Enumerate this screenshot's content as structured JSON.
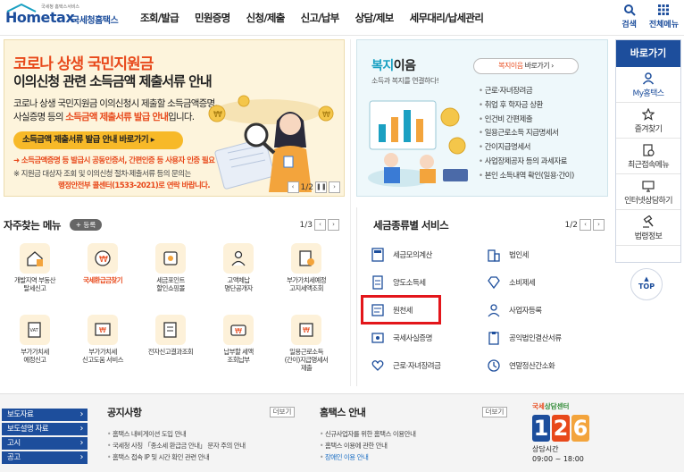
{
  "header": {
    "logo_brand": "Hometax",
    "logo_sub": "국세청 홈택스서비스",
    "logo_agency": "국세청홈택스",
    "menus": [
      "조회/발급",
      "민원증명",
      "신청/제출",
      "신고/납부",
      "상담/제보",
      "세무대리/납세관리"
    ],
    "search_label": "검색",
    "allmenu_label": "전체메뉴"
  },
  "banner": {
    "title1": "코로나 상생 국민지원금",
    "title2": "이의신청 관련 소득금액 제출서류 안내",
    "desc1": "코로나 상생 국민지원금 이의신청시 제출할 소득금액증명,",
    "desc2_pre": "사실증명 등의 ",
    "desc2_hl": "소득금액 제출서류 발급 안내",
    "desc2_post": "입니다.",
    "button": "소득금액 제출서류 발급 안내 바로가기",
    "note1": "➜ 소득금액증명 등 발급시 공동인증서, 간편인증 등 사용자 인증 필요",
    "note2": "※ 지원금 대상자 조회 및 이의신청 절차·제출서류 등의 문의는",
    "note3": "행정안전부 콜센터(1533-2021)로 연락 바랍니다.",
    "pager": "1/2"
  },
  "welfare": {
    "title_hl": "복지",
    "title_dk": "이음",
    "subtitle": "소득과 복지를 연결하다!",
    "go_hl": "복지이음",
    "go_label": " 바로가기",
    "items": [
      "근로·자녀장려금",
      "취업 후 학자금 상환",
      "인건비 간편제출",
      "일용근로소득 지급명세서",
      "간이지급명세서",
      "사업장제공자 등의 과세자료",
      "본인 소득내역 확인(일용·간이)"
    ]
  },
  "quick": {
    "header": "바로가기",
    "items": [
      "My홈택스",
      "즐겨찾기",
      "최근접속메뉴",
      "인터넷상담하기",
      "법령정보"
    ],
    "top": "TOP"
  },
  "freq": {
    "title": "자주찾는 메뉴",
    "register": "+ 등록",
    "pager": "1/3",
    "items": [
      {
        "label": "개발지역 부동산\n탈세신고",
        "red": false
      },
      {
        "label": "국세환급금찾기",
        "red": true
      },
      {
        "label": "세금포인트\n할인쇼핑몰",
        "red": false
      },
      {
        "label": "고액체납\n명단공개자",
        "red": false
      },
      {
        "label": "부가가치세예정\n고지세액조회",
        "red": false
      },
      {
        "label": "부가가치세\n예정신고",
        "red": false
      },
      {
        "label": "부가가치세\n신고도움 서비스",
        "red": false
      },
      {
        "label": "전자신고결과조회",
        "red": false
      },
      {
        "label": "납부할 세액\n조회납부",
        "red": false
      },
      {
        "label": "일용근로소득\n(간이)지급명세서\n제출",
        "red": false
      }
    ]
  },
  "taxsvc": {
    "title": "세금종류별 서비스",
    "pager": "1/2",
    "items": [
      "세금모의계산",
      "법인세",
      "양도소득세",
      "소비제세",
      "원천세",
      "사업자등록",
      "국세사실증명",
      "공익법인결산서류",
      "근로·자녀장려금",
      "연말정산간소화"
    ]
  },
  "footer": {
    "left_buttons": [
      "보도자료",
      "보도설명 자료",
      "고시",
      "공고"
    ],
    "notice_title": "공지사항",
    "notice_more": "더보기",
    "notices": [
      "홈택스 내비게이션 도입 안내",
      "국세청 사칭 「종소세 환급금 안내」 문자 주의 안내",
      "홈택스 접속 IP 및 시간 확인 관련 안내"
    ],
    "news_title": "홈택스 안내",
    "news_more": "더보기",
    "news": [
      "신규사업자를 위한 홈택스 이용안내",
      "홈택스 이용에 관한 안내",
      "장애인 이용 안내"
    ],
    "cc_title_hl": "국세",
    "cc_title": "상담센터",
    "cc_digits": [
      "1",
      "2",
      "6"
    ],
    "cc_hours_label": "상담시간",
    "cc_hours": "09:00 ~ 18:00"
  }
}
